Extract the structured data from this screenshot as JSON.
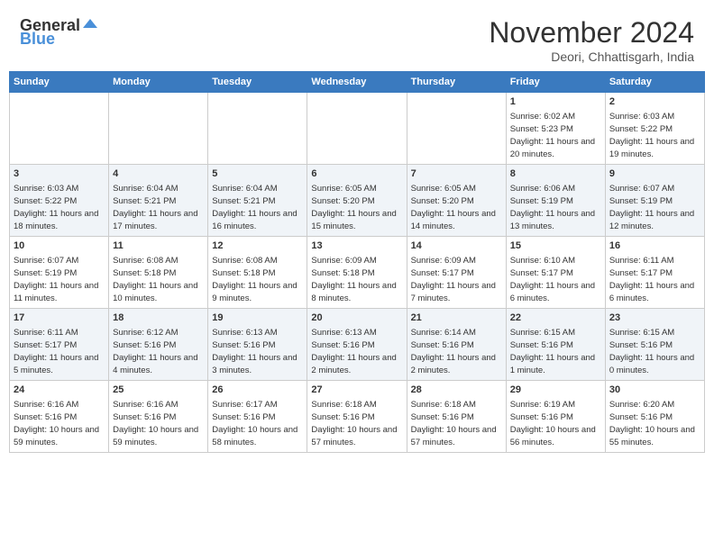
{
  "header": {
    "logo_general": "General",
    "logo_blue": "Blue",
    "month": "November 2024",
    "location": "Deori, Chhattisgarh, India"
  },
  "weekdays": [
    "Sunday",
    "Monday",
    "Tuesday",
    "Wednesday",
    "Thursday",
    "Friday",
    "Saturday"
  ],
  "weeks": [
    [
      {
        "day": "",
        "info": ""
      },
      {
        "day": "",
        "info": ""
      },
      {
        "day": "",
        "info": ""
      },
      {
        "day": "",
        "info": ""
      },
      {
        "day": "",
        "info": ""
      },
      {
        "day": "1",
        "info": "Sunrise: 6:02 AM\nSunset: 5:23 PM\nDaylight: 11 hours\nand 20 minutes."
      },
      {
        "day": "2",
        "info": "Sunrise: 6:03 AM\nSunset: 5:22 PM\nDaylight: 11 hours\nand 19 minutes."
      }
    ],
    [
      {
        "day": "3",
        "info": "Sunrise: 6:03 AM\nSunset: 5:22 PM\nDaylight: 11 hours\nand 18 minutes."
      },
      {
        "day": "4",
        "info": "Sunrise: 6:04 AM\nSunset: 5:21 PM\nDaylight: 11 hours\nand 17 minutes."
      },
      {
        "day": "5",
        "info": "Sunrise: 6:04 AM\nSunset: 5:21 PM\nDaylight: 11 hours\nand 16 minutes."
      },
      {
        "day": "6",
        "info": "Sunrise: 6:05 AM\nSunset: 5:20 PM\nDaylight: 11 hours\nand 15 minutes."
      },
      {
        "day": "7",
        "info": "Sunrise: 6:05 AM\nSunset: 5:20 PM\nDaylight: 11 hours\nand 14 minutes."
      },
      {
        "day": "8",
        "info": "Sunrise: 6:06 AM\nSunset: 5:19 PM\nDaylight: 11 hours\nand 13 minutes."
      },
      {
        "day": "9",
        "info": "Sunrise: 6:07 AM\nSunset: 5:19 PM\nDaylight: 11 hours\nand 12 minutes."
      }
    ],
    [
      {
        "day": "10",
        "info": "Sunrise: 6:07 AM\nSunset: 5:19 PM\nDaylight: 11 hours\nand 11 minutes."
      },
      {
        "day": "11",
        "info": "Sunrise: 6:08 AM\nSunset: 5:18 PM\nDaylight: 11 hours\nand 10 minutes."
      },
      {
        "day": "12",
        "info": "Sunrise: 6:08 AM\nSunset: 5:18 PM\nDaylight: 11 hours\nand 9 minutes."
      },
      {
        "day": "13",
        "info": "Sunrise: 6:09 AM\nSunset: 5:18 PM\nDaylight: 11 hours\nand 8 minutes."
      },
      {
        "day": "14",
        "info": "Sunrise: 6:09 AM\nSunset: 5:17 PM\nDaylight: 11 hours\nand 7 minutes."
      },
      {
        "day": "15",
        "info": "Sunrise: 6:10 AM\nSunset: 5:17 PM\nDaylight: 11 hours\nand 6 minutes."
      },
      {
        "day": "16",
        "info": "Sunrise: 6:11 AM\nSunset: 5:17 PM\nDaylight: 11 hours\nand 6 minutes."
      }
    ],
    [
      {
        "day": "17",
        "info": "Sunrise: 6:11 AM\nSunset: 5:17 PM\nDaylight: 11 hours\nand 5 minutes."
      },
      {
        "day": "18",
        "info": "Sunrise: 6:12 AM\nSunset: 5:16 PM\nDaylight: 11 hours\nand 4 minutes."
      },
      {
        "day": "19",
        "info": "Sunrise: 6:13 AM\nSunset: 5:16 PM\nDaylight: 11 hours\nand 3 minutes."
      },
      {
        "day": "20",
        "info": "Sunrise: 6:13 AM\nSunset: 5:16 PM\nDaylight: 11 hours\nand 2 minutes."
      },
      {
        "day": "21",
        "info": "Sunrise: 6:14 AM\nSunset: 5:16 PM\nDaylight: 11 hours\nand 2 minutes."
      },
      {
        "day": "22",
        "info": "Sunrise: 6:15 AM\nSunset: 5:16 PM\nDaylight: 11 hours\nand 1 minute."
      },
      {
        "day": "23",
        "info": "Sunrise: 6:15 AM\nSunset: 5:16 PM\nDaylight: 11 hours\nand 0 minutes."
      }
    ],
    [
      {
        "day": "24",
        "info": "Sunrise: 6:16 AM\nSunset: 5:16 PM\nDaylight: 10 hours\nand 59 minutes."
      },
      {
        "day": "25",
        "info": "Sunrise: 6:16 AM\nSunset: 5:16 PM\nDaylight: 10 hours\nand 59 minutes."
      },
      {
        "day": "26",
        "info": "Sunrise: 6:17 AM\nSunset: 5:16 PM\nDaylight: 10 hours\nand 58 minutes."
      },
      {
        "day": "27",
        "info": "Sunrise: 6:18 AM\nSunset: 5:16 PM\nDaylight: 10 hours\nand 57 minutes."
      },
      {
        "day": "28",
        "info": "Sunrise: 6:18 AM\nSunset: 5:16 PM\nDaylight: 10 hours\nand 57 minutes."
      },
      {
        "day": "29",
        "info": "Sunrise: 6:19 AM\nSunset: 5:16 PM\nDaylight: 10 hours\nand 56 minutes."
      },
      {
        "day": "30",
        "info": "Sunrise: 6:20 AM\nSunset: 5:16 PM\nDaylight: 10 hours\nand 55 minutes."
      }
    ]
  ]
}
